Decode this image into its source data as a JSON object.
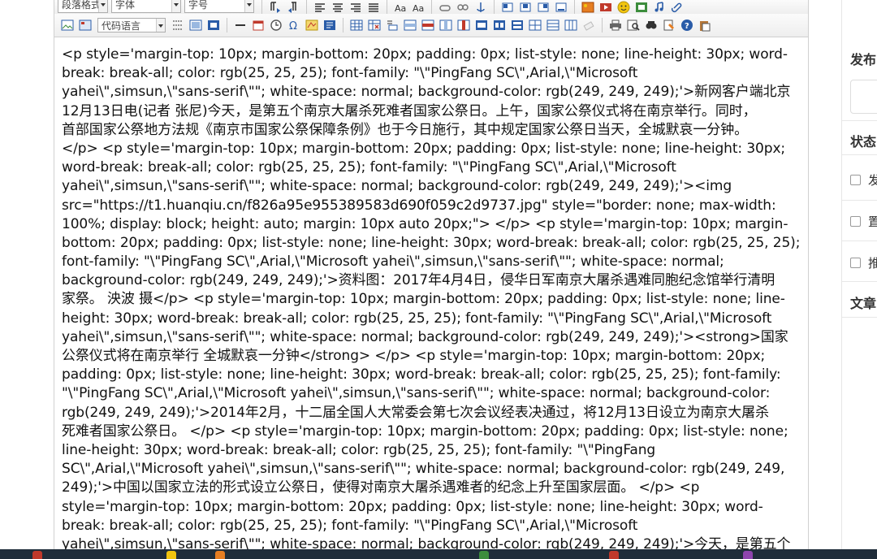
{
  "toolbar": {
    "paragraph_format": "段落格式",
    "font_family": "字体",
    "font_size": "字号",
    "code_language": "代码语言",
    "colors": {
      "blue": "#2a5ca8",
      "red": "#c0392b",
      "green": "#3c8d3c",
      "orange": "#e67e22",
      "yellow": "#f1c40f"
    }
  },
  "editor": {
    "lines": [
      "<p style='margin-top: 10px; margin-bottom: 20px; padding: 0px; list-style: none; line-height: 30px; word-",
      "break: break-all; color: rgb(25, 25, 25); font-family: \"\\\"PingFang SC\\\",Arial,\\\"Microsoft",
      "yahei\\\",simsun,\\\"sans-serif\\\"\"; white-space: normal; background-color: rgb(249, 249, 249);'>新网客户端北京",
      "12月13日电(记者 张尼)今天，是第五个南京大屠杀死难者国家公祭日。上午，国家公祭仪式将在南京举行。同时，",
      "首部国家公祭地方法规《南京市国家公祭保障条例》也于今日施行，其中规定国家公祭日当天，全城默哀一分钟。",
      "</p> <p style='margin-top: 10px; margin-bottom: 20px; padding: 0px; list-style: none; line-height: 30px;",
      "word-break: break-all; color: rgb(25, 25, 25); font-family: \"\\\"PingFang SC\\\",Arial,\\\"Microsoft",
      "yahei\\\",simsun,\\\"sans-serif\\\"\"; white-space: normal; background-color: rgb(249, 249, 249);'><img",
      "src=\"https://t1.huanqiu.cn/f826a95e955389583d690f059c2d9737.jpg\" style=\"border: none; max-width:",
      "100%; display: block; height: auto; margin: 10px auto 20px;\"> </p> <p style='margin-top: 10px; margin-",
      "bottom: 20px; padding: 0px; list-style: none; line-height: 30px; word-break: break-all; color: rgb(25, 25, 25);",
      "font-family: \"\\\"PingFang SC\\\",Arial,\\\"Microsoft yahei\\\",simsun,\\\"sans-serif\\\"\"; white-space: normal;",
      "background-color: rgb(249, 249, 249);'>资料图：2017年4月4日，侵华日军南京大屠杀遇难同胞纪念馆举行清明",
      "家祭。 泱波 摄</p> <p style='margin-top: 10px; margin-bottom: 20px; padding: 0px; list-style: none; line-",
      "height: 30px; word-break: break-all; color: rgb(25, 25, 25); font-family: \"\\\"PingFang SC\\\",Arial,\\\"Microsoft",
      "yahei\\\",simsun,\\\"sans-serif\\\"\"; white-space: normal; background-color: rgb(249, 249, 249);'><strong>国家",
      "公祭仪式将在南京举行 全城默哀一分钟</strong> </p> <p style='margin-top: 10px; margin-bottom: 20px;",
      "padding: 0px; list-style: none; line-height: 30px; word-break: break-all; color: rgb(25, 25, 25); font-family:",
      "\"\\\"PingFang SC\\\",Arial,\\\"Microsoft yahei\\\",simsun,\\\"sans-serif\\\"\"; white-space: normal; background-color:",
      "rgb(249, 249, 249);'>2014年2月，十二届全国人大常委会第七次会议经表决通过，将12月13日设立为南京大屠杀",
      "死难者国家公祭日。 </p> <p style='margin-top: 10px; margin-bottom: 20px; padding: 0px; list-style: none;",
      "line-height: 30px; word-break: break-all; color: rgb(25, 25, 25); font-family: \"\\\"PingFang",
      "SC\\\",Arial,\\\"Microsoft yahei\\\",simsun,\\\"sans-serif\\\"\"; white-space: normal; background-color: rgb(249, 249,",
      "249);'>中国以国家立法的形式设立公祭日，使得对南京大屠杀遇难者的纪念上升至国家层面。 </p> <p",
      "style='margin-top: 10px; margin-bottom: 20px; padding: 0px; list-style: none; line-height: 30px; word-",
      "break: break-all; color: rgb(25, 25, 25); font-family: \"\\\"PingFang SC\\\",Arial,\\\"Microsoft",
      "yahei\\\",simsun,\\\"sans-serif\\\"\"; white-space: normal; background-color: rgb(249, 249, 249);'>今天，是第五个"
    ]
  },
  "sidebar": {
    "publish_title": "发布",
    "status_title": "状态",
    "status_options": [
      "发",
      "置",
      "推"
    ],
    "article_title": "文章"
  }
}
